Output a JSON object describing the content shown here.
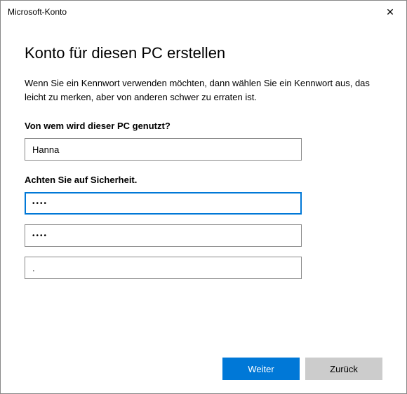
{
  "window": {
    "title": "Microsoft-Konto",
    "close_label": "✕"
  },
  "page": {
    "heading": "Konto für diesen PC erstellen",
    "subtext": "Wenn Sie ein Kennwort verwenden möchten, dann wählen Sie ein Kennwort aus, das leicht zu merken, aber von anderen schwer zu erraten ist."
  },
  "form": {
    "username_label": "Von wem wird dieser PC genutzt?",
    "username_value": "Hanna",
    "password_label": "Achten Sie auf Sicherheit.",
    "password_value": "••••",
    "password_confirm_value": "••••",
    "hint_value": "."
  },
  "buttons": {
    "primary": "Weiter",
    "secondary": "Zurück"
  }
}
